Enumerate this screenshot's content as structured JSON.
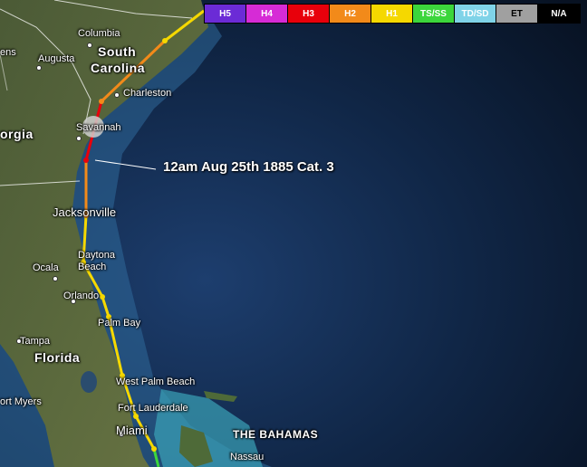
{
  "legend": [
    {
      "label": "H5",
      "color": "#6b2bd6",
      "text_color": "#ffffff"
    },
    {
      "label": "H4",
      "color": "#d62bd6",
      "text_color": "#ffffff"
    },
    {
      "label": "H3",
      "color": "#e8000b",
      "text_color": "#ffffff"
    },
    {
      "label": "H2",
      "color": "#f28a1a",
      "text_color": "#ffffff"
    },
    {
      "label": "H1",
      "color": "#f5d800",
      "text_color": "#ffffff"
    },
    {
      "label": "TS/SS",
      "color": "#3cd63c",
      "text_color": "#ffffff"
    },
    {
      "label": "TD/SD",
      "color": "#7fd3e8",
      "text_color": "#ffffff"
    },
    {
      "label": "ET",
      "color": "#a0a0a0",
      "text_color": "#000000"
    },
    {
      "label": "N/A",
      "color": "#000000",
      "text_color": "#ffffff"
    }
  ],
  "annotation": "12am Aug 25th 1885 Cat. 3",
  "labels": {
    "columbia": "Columbia",
    "south": "South",
    "carolina": "Carolina",
    "augusta": "Augusta",
    "ens": "ens",
    "charleston": "Charleston",
    "orgia": "orgia",
    "savannah": "Savannah",
    "jacksonville": "Jacksonville",
    "daytona": "Daytona",
    "beach": "Beach",
    "ocala": "Ocala",
    "orlando": "Orlando",
    "palm_bay": "Palm Bay",
    "tampa": "Tampa",
    "florida": "Florida",
    "west_palm_beach": "West Palm Beach",
    "fort_myers": "ort Myers",
    "fort_lauderdale": "Fort Lauderdale",
    "miami": "Miami",
    "the_bahamas": "THE BAHAMAS",
    "nassau": "Nassau"
  }
}
